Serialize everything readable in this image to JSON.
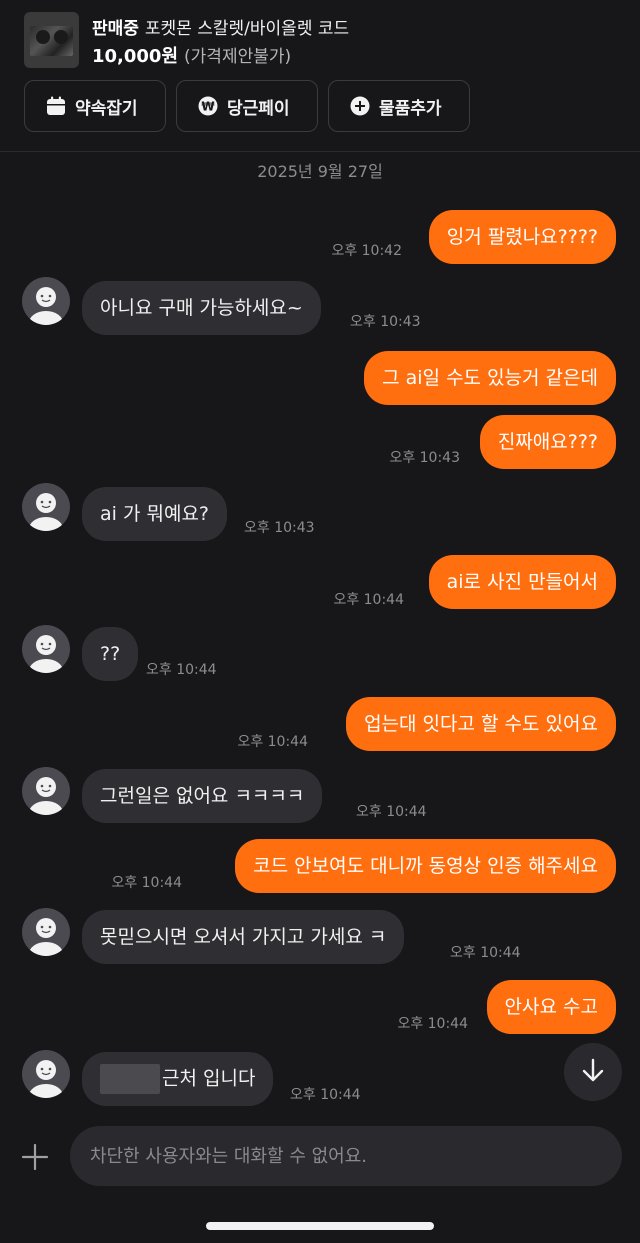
{
  "header": {
    "status": "판매중",
    "title": "포켓몬 스칼렛/바이올렛 코드",
    "price": "10,000원",
    "price_note": "(가격제안불가)",
    "actions": [
      {
        "label": "약속잡기",
        "icon": "calendar-icon"
      },
      {
        "label": "당근페이",
        "icon": "won-pay-icon"
      },
      {
        "label": "물품추가",
        "icon": "plus-circle-icon"
      }
    ]
  },
  "chat": {
    "date": "2025년 9월 27일",
    "messages": [
      {
        "from": "me",
        "text": "잉거 팔렸나요????",
        "time": "오후 10:42"
      },
      {
        "from": "them",
        "text": "아니요 구매 가능하세요~",
        "time": "오후 10:43"
      },
      {
        "from": "me",
        "text": "그 ai일 수도 있능거 같은데",
        "time": ""
      },
      {
        "from": "me",
        "text": "진짜애요???",
        "time": "오후 10:43"
      },
      {
        "from": "them",
        "text": "ai 가 뭐예요?",
        "time": "오후 10:43"
      },
      {
        "from": "me",
        "text": "ai로 사진 만들어서",
        "time": "오후 10:44"
      },
      {
        "from": "them",
        "text": "??",
        "time": "오후 10:44"
      },
      {
        "from": "me",
        "text": "업는대 잇다고 할 수도 있어요",
        "time": "오후 10:44"
      },
      {
        "from": "them",
        "text": "그런일은 없어요 ㅋㅋㅋㅋ",
        "time": "오후 10:44"
      },
      {
        "from": "me",
        "text": "코드 안보여도 대니까 동영상 인증 해주세요",
        "time": "오후 10:44"
      },
      {
        "from": "them",
        "text": "못믿으시면 오셔서 가지고 가세요 ㅋ",
        "time": "오후 10:44"
      },
      {
        "from": "me",
        "text": "안사요 수고",
        "time": "오후 10:44"
      },
      {
        "from": "them",
        "text": "근처 입니다",
        "time": "오후 10:44",
        "redacted_prefix": true
      }
    ]
  },
  "composer": {
    "placeholder": "차단한 사용자와는 대화할 수 없어요.",
    "icon": "plus-icon"
  },
  "colors": {
    "accent": "#ff6f0f",
    "background": "#17171a",
    "their_bubble": "#2e2e33"
  }
}
